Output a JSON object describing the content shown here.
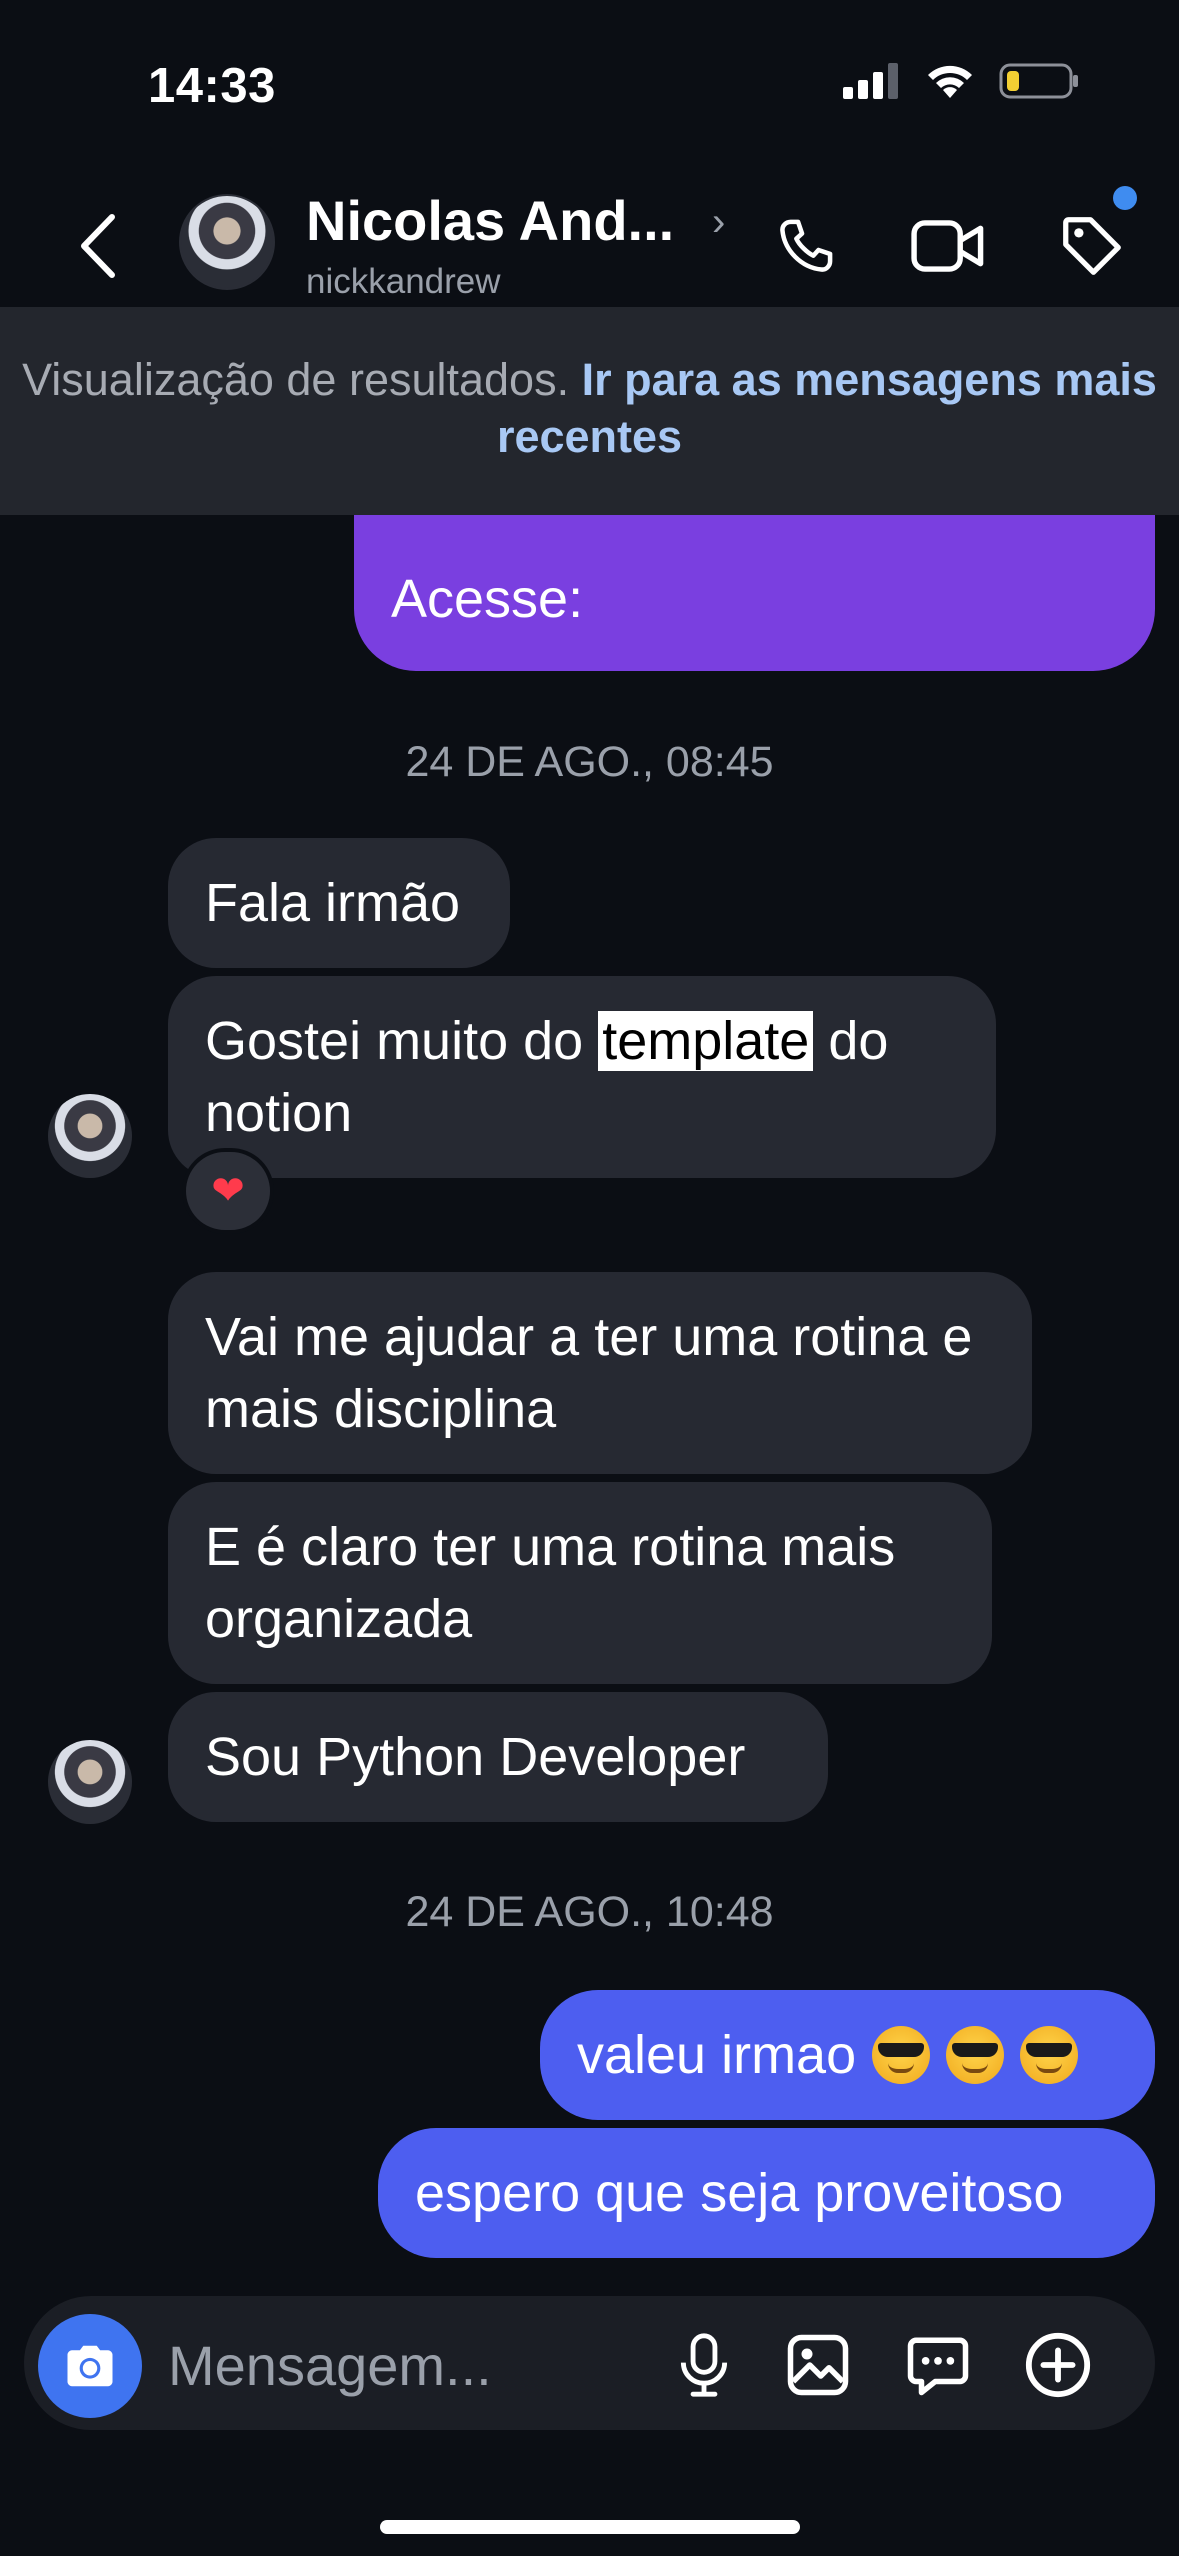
{
  "status_bar": {
    "time": "14:33"
  },
  "header": {
    "name": "Nicolas And...",
    "username": "nickkandrew"
  },
  "banner": {
    "text": "Visualização de resultados.",
    "link": "Ir para as mensagens mais recentes"
  },
  "messages": {
    "purple_fragment": "Acesse:",
    "timestamp_1": "24 DE AGO., 08:45",
    "incoming_1": "Fala irmão",
    "incoming_2_before": "Gostei muito do ",
    "incoming_2_highlight": "template",
    "incoming_2_after": " do notion",
    "reaction": "❤",
    "incoming_3": "Vai me ajudar a ter uma rotina e mais disciplina",
    "incoming_4": "E é claro ter uma rotina mais organizada",
    "incoming_5": "Sou Python Developer",
    "timestamp_2": "24 DE AGO., 10:48",
    "outgoing_1": "valeu irmao",
    "outgoing_2": "espero que seja proveitoso"
  },
  "composer": {
    "placeholder": "Mensagem..."
  },
  "colors": {
    "background": "#0b0e14",
    "incoming_bubble": "#262932",
    "outgoing_bubble": "#4d5ef0",
    "purple_bubble": "#7a3fe0",
    "link": "#a8c8f4",
    "camera_button": "#3f74f0"
  },
  "icons": [
    "signal-icon",
    "wifi-icon",
    "battery-icon",
    "back-chevron-icon",
    "phone-icon",
    "video-camera-icon",
    "tag-icon",
    "camera-icon",
    "microphone-icon",
    "gallery-icon",
    "sticker-icon",
    "plus-circle-icon"
  ]
}
